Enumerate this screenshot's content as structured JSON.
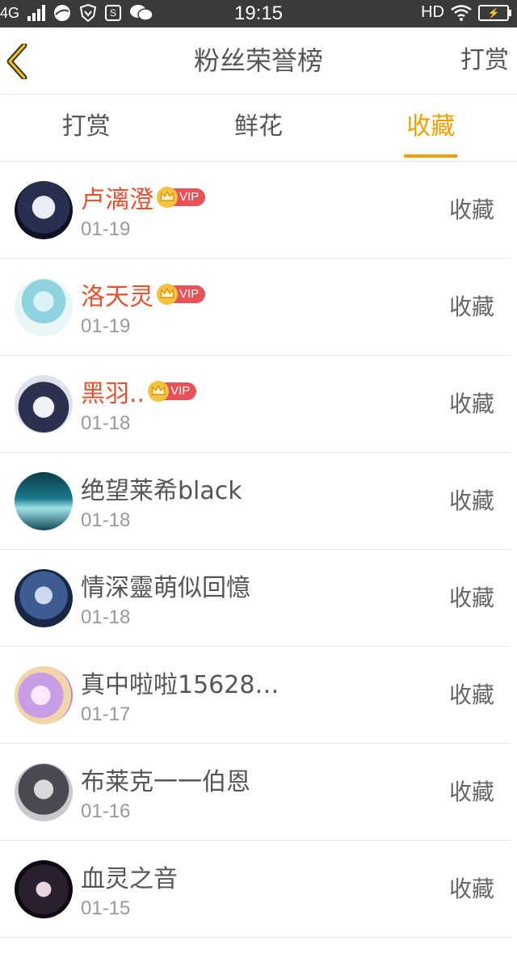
{
  "status_bar": {
    "network": "4G",
    "time": "19:15",
    "hd": "HD"
  },
  "header": {
    "title": "粉丝荣誉榜",
    "action": "打赏"
  },
  "tabs": [
    {
      "label": "打赏",
      "active": false
    },
    {
      "label": "鲜花",
      "active": false
    },
    {
      "label": "收藏",
      "active": true
    }
  ],
  "accent_color": "#f0a000",
  "vip_name_color": "#e8502e",
  "vip_label": "VIP",
  "items": [
    {
      "name": "卢漓澄",
      "date": "01-19",
      "vip": true,
      "action": "收藏"
    },
    {
      "name": "洛天灵",
      "date": "01-19",
      "vip": true,
      "action": "收藏"
    },
    {
      "name": "黑羽..",
      "date": "01-18",
      "vip": true,
      "action": "收藏"
    },
    {
      "name": "绝望莱希black",
      "date": "01-18",
      "vip": false,
      "action": "收藏"
    },
    {
      "name": "情深靈萌似回憶",
      "date": "01-18",
      "vip": false,
      "action": "收藏"
    },
    {
      "name": "真中啦啦15628…",
      "date": "01-17",
      "vip": false,
      "action": "收藏"
    },
    {
      "name": "布莱克一一伯恩",
      "date": "01-16",
      "vip": false,
      "action": "收藏"
    },
    {
      "name": "血灵之音",
      "date": "01-15",
      "vip": false,
      "action": "收藏"
    }
  ]
}
